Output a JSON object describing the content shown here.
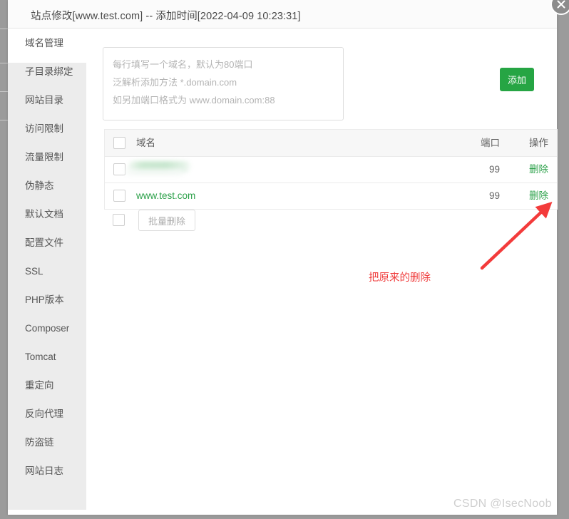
{
  "window": {
    "title": "站点修改[www.test.com] -- 添加时间[2022-04-09 10:23:31]",
    "close_label": "×"
  },
  "sidebar": {
    "items": [
      {
        "label": "域名管理",
        "active": true
      },
      {
        "label": "子目录绑定",
        "active": false
      },
      {
        "label": "网站目录",
        "active": false
      },
      {
        "label": "访问限制",
        "active": false
      },
      {
        "label": "流量限制",
        "active": false
      },
      {
        "label": "伪静态",
        "active": false
      },
      {
        "label": "默认文档",
        "active": false
      },
      {
        "label": "配置文件",
        "active": false
      },
      {
        "label": "SSL",
        "active": false
      },
      {
        "label": "PHP版本",
        "active": false
      },
      {
        "label": "Composer",
        "active": false
      },
      {
        "label": "Tomcat",
        "active": false
      },
      {
        "label": "重定向",
        "active": false
      },
      {
        "label": "反向代理",
        "active": false
      },
      {
        "label": "防盗链",
        "active": false
      },
      {
        "label": "网站日志",
        "active": false
      }
    ]
  },
  "form": {
    "textarea_value": "",
    "placeholder_line1": "每行填写一个域名，默认为80端口",
    "placeholder_line2": "泛解析添加方法 *.domain.com",
    "placeholder_line3": "如另加端口格式为 www.domain.com:88",
    "placeholder_full": "每行填写一个域名，默认为80端口\n泛解析添加方法 *.domain.com\n如另加端口格式为 www.domain.com:88",
    "add_button": "添加"
  },
  "table": {
    "headers": {
      "domain": "域名",
      "port": "端口",
      "action": "操作"
    },
    "rows": [
      {
        "domain": "",
        "redacted": true,
        "port": "99",
        "action": "删除"
      },
      {
        "domain": "www.test.com",
        "redacted": false,
        "port": "99",
        "action": "删除"
      }
    ]
  },
  "batch": {
    "button_label": "批量删除"
  },
  "annotation": {
    "text": "把原来的删除",
    "color": "#ef3b3b"
  },
  "watermark": {
    "text": "CSDN @IsecNoob"
  },
  "colors": {
    "accent_green": "#26a544",
    "link_green": "#2ca14a",
    "annotation_red": "#ef3b3b",
    "sidebar_gray": "#ececec",
    "header_gray": "#fbfbfb"
  }
}
